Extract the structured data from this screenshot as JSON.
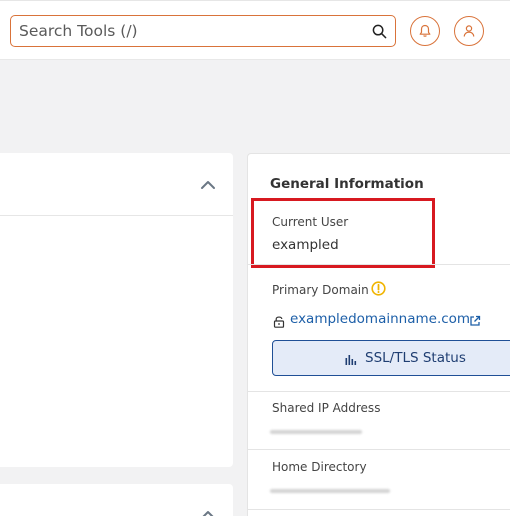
{
  "header": {
    "search": {
      "placeholder": "Search Tools (/)",
      "value": ""
    },
    "icons": {
      "search": "search-icon",
      "notifications": "bell-icon",
      "account": "user-icon"
    }
  },
  "general_info": {
    "title": "General Information",
    "current_user": {
      "label": "Current User",
      "value": "exampled"
    },
    "primary_domain": {
      "label": "Primary Domain",
      "value": "exampledomainname.com",
      "warning_icon": "warning-icon",
      "lock_icon": "lock-icon",
      "external_icon": "external-link-icon"
    },
    "ssl_button": {
      "label": "SSL/TLS Status",
      "icon": "bar-chart-icon"
    },
    "shared_ip": {
      "label": "Shared IP Address",
      "value_redacted": true
    },
    "home_directory": {
      "label": "Home Directory",
      "value_redacted": true
    }
  },
  "colors": {
    "accent": "#d9733a",
    "highlight": "#d71920",
    "link": "#1d5fa8",
    "button_bg": "#e4ebf8",
    "button_border": "#1f4f96",
    "warning": "#f0b400",
    "page_bg": "#f2f2f3"
  }
}
